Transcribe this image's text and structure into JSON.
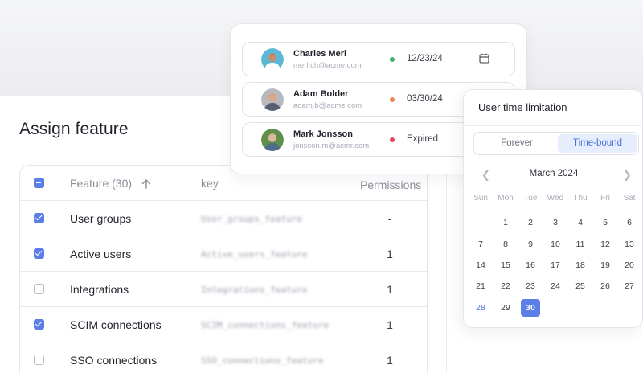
{
  "assign": {
    "title": "Assign feature",
    "header": {
      "feature_label": "Feature (30)",
      "key_label": "key",
      "permissions_label": "Permissions"
    },
    "rows": [
      {
        "name": "User groups",
        "key": "User_groups_feature",
        "permission": "-",
        "checked": true
      },
      {
        "name": "Active users",
        "key": "Active_users_feature",
        "permission": "1",
        "checked": true
      },
      {
        "name": "Integrations",
        "key": "Integrations_feature",
        "permission": "1",
        "checked": false
      },
      {
        "name": "SCIM connections",
        "key": "SCIM_connections_feature",
        "permission": "1",
        "checked": true
      },
      {
        "name": "SSO connections",
        "key": "SSO_connections_feature",
        "permission": "1",
        "checked": false
      }
    ]
  },
  "users": [
    {
      "name": "Charles Merl",
      "email": "merl.ch@acme.com",
      "date": "12/23/24",
      "status_color": "#3bb26b"
    },
    {
      "name": "Adam Bolder",
      "email": "adam.b@acme.com",
      "date": "03/30/24",
      "status_color": "#f0844a"
    },
    {
      "name": "Mark Jonsson",
      "email": "jonsson.m@acmr.com",
      "date": "Expired",
      "status_color": "#e0475a"
    }
  ],
  "time_limit": {
    "title": "User time limitation",
    "options": [
      "Forever",
      "Time-bound"
    ],
    "selected_option": "Time-bound",
    "month": "March 2024",
    "weekdays": [
      "Sun",
      "Mon",
      "Tue",
      "Wed",
      "Thu",
      "Fri",
      "Sat"
    ],
    "weeks": [
      [
        "",
        "1",
        "2",
        "3",
        "4",
        "5",
        "6"
      ],
      [
        "7",
        "8",
        "9",
        "10",
        "11",
        "12",
        "13"
      ],
      [
        "14",
        "15",
        "16",
        "17",
        "18",
        "19",
        "20"
      ],
      [
        "21",
        "22",
        "23",
        "24",
        "25",
        "26",
        "27"
      ],
      [
        "28",
        "29",
        "30",
        "",
        "",
        "",
        ""
      ]
    ],
    "today": "28",
    "selected_day": "30"
  },
  "colors": {
    "accent": "#5b7fe6",
    "accent_light": "#e6edfd"
  }
}
